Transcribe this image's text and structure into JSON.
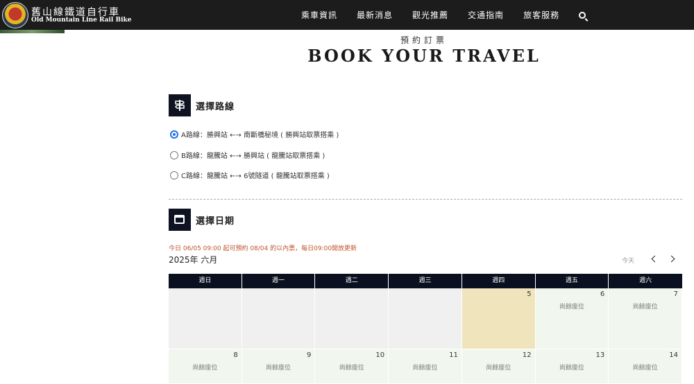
{
  "brand": {
    "name_zh": "舊山線鐵道自行車",
    "name_en": "Old Mountain Line Rail Bike"
  },
  "nav": {
    "items": [
      "乘車資訊",
      "最新消息",
      "觀光推薦",
      "交通指南",
      "旅客服務"
    ]
  },
  "page": {
    "subtitle": "預約訂票",
    "title": "BOOK YOUR TRAVEL"
  },
  "route_section": {
    "title": "選擇路線",
    "routes": [
      {
        "label": "A路線：勝興站 ←→ 南斷橋秘境 ( 勝興站取票搭乘 )",
        "selected": true
      },
      {
        "label": "B路線：龍騰站 ←→ 勝興站 ( 龍騰站取票搭乘 )",
        "selected": false
      },
      {
        "label": "C路線：龍騰站 ←→ 6號隧道 ( 龍騰站取票搭乘 )",
        "selected": false
      }
    ]
  },
  "date_section": {
    "title": "選擇日期",
    "notice": "今日 06/05 09:00 起可預約 08/04 的以內票，每日09:00開放更新",
    "month_label": "2025年 六月",
    "today_label": "今天",
    "weekdays": [
      "週日",
      "週一",
      "週二",
      "週三",
      "週四",
      "週五",
      "週六"
    ],
    "weeks": [
      [
        {
          "day": "",
          "status": ""
        },
        {
          "day": "",
          "status": ""
        },
        {
          "day": "",
          "status": ""
        },
        {
          "day": "",
          "status": ""
        },
        {
          "day": "5",
          "status": ""
        },
        {
          "day": "6",
          "status": "尚餘座位"
        },
        {
          "day": "7",
          "status": "尚餘座位"
        }
      ],
      [
        {
          "day": "8",
          "status": "尚餘座位"
        },
        {
          "day": "9",
          "status": "尚餘座位"
        },
        {
          "day": "10",
          "status": "尚餘座位"
        },
        {
          "day": "11",
          "status": "尚餘座位"
        },
        {
          "day": "12",
          "status": "尚餘座位"
        },
        {
          "day": "13",
          "status": "尚餘座位"
        },
        {
          "day": "14",
          "status": "尚餘座位"
        }
      ]
    ]
  },
  "colors": {
    "nav_bg": "#1c1c1c",
    "header_bg": "#0b1020",
    "today_bg": "#efe4bb",
    "available_bg": "#f1f7ee",
    "notice": "#c0532c",
    "radio_accent": "#1a73e8"
  }
}
